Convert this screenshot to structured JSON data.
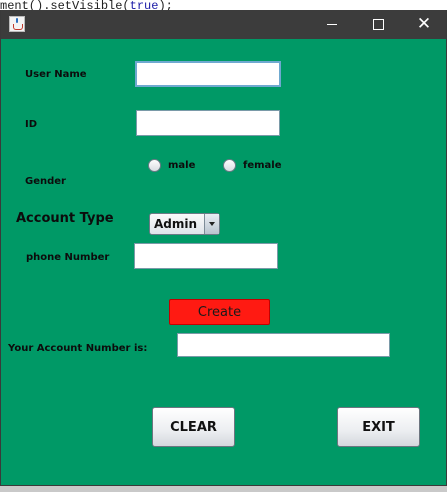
{
  "background": {
    "code_prefix": "ment().setVisible(",
    "code_keyword": "true",
    "code_suffix": ");"
  },
  "window": {
    "title": "",
    "icon": "java-cup-icon",
    "controls": {
      "minimize": "minimize-icon",
      "maximize": "maximize-icon",
      "close": "close-icon"
    }
  },
  "colors": {
    "panel_bg": "#009966",
    "create_button_bg": "#ff1a12",
    "title_bar": "#3c3c3c"
  },
  "form": {
    "username_label": "User Name",
    "username_value": "",
    "id_label": "ID",
    "id_value": "",
    "gender_label": "Gender",
    "gender_options": {
      "male": "male",
      "female": "female"
    },
    "gender_selected": "",
    "account_type_label": "Account Type",
    "account_type_selected": "Admin",
    "phone_label": "phone Number",
    "phone_value": "",
    "create_label": "Create",
    "account_number_label": "Your Account Number is:",
    "account_number_value": "",
    "clear_label": "CLEAR",
    "exit_label": "EXIT"
  }
}
